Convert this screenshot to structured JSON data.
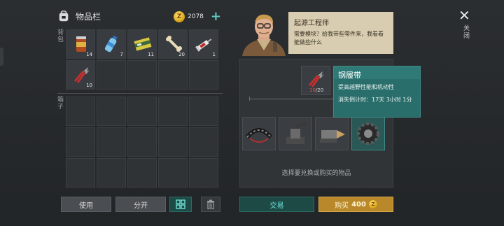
{
  "inventory": {
    "title": "物品栏",
    "coins": "2078",
    "section_top": "背包",
    "section_bottom": "箱子",
    "top_items": [
      {
        "icon": "canned-food-icon",
        "qty": "14"
      },
      {
        "icon": "water-bottle-icon",
        "qty": "7"
      },
      {
        "icon": "battery-box-icon",
        "qty": "11"
      },
      {
        "icon": "bone-icon",
        "qty": "20"
      },
      {
        "icon": "syringe-icon",
        "qty": "1"
      },
      {
        "icon": "pliers-icon",
        "qty": "10"
      }
    ]
  },
  "buttons": {
    "use": "使用",
    "split": "分开",
    "trade": "交易",
    "buy_prefix": "购买",
    "buy_price": "400"
  },
  "npc": {
    "name": "起源工程师",
    "line": "需要模块？给我带些零件来，我看看能做些什么"
  },
  "trade": {
    "selected_count_have": "10",
    "selected_count_need": "/20",
    "hint": "选择要兑换或购买的物品",
    "items": [
      {
        "icon": "tire-belt-icon"
      },
      {
        "icon": "cannon-mount-icon"
      },
      {
        "icon": "drill-module-icon"
      },
      {
        "icon": "gear-cog-icon"
      }
    ]
  },
  "tooltip": {
    "title": "钢履带",
    "description": "提高越野性能和机动性",
    "timer": "消失倒计时：17天 3小时 1分"
  },
  "close": {
    "label": "关闭"
  },
  "colors": {
    "accent_teal": "#2a6e6b",
    "gold": "#b8882a",
    "bubble": "#d8cdb0"
  }
}
